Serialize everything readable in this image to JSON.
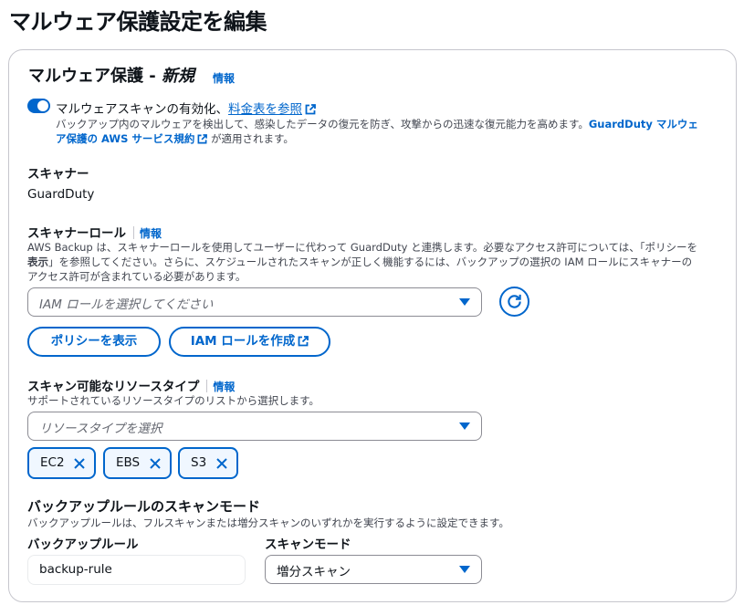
{
  "page": {
    "title": "マルウェア保護設定を編集"
  },
  "card": {
    "title": "マルウェア保護 - ",
    "title_new": "新規",
    "info": "情報"
  },
  "toggle": {
    "enabled": true,
    "label": "マルウェアスキャンの有効化、",
    "pricing_link": "料金表を参照",
    "desc_line1_text": "バックアップ内のマルウェアを検出して、感染したデータの復元を防ぎ、攻撃からの迅速な復元能力を高めます。",
    "desc_line1_link": "GuardDuty マルウェ",
    "desc_line2_link": "ア保護の AWS サービス規約",
    "desc_line2_suffix": " が適用されます。"
  },
  "scanner": {
    "label": "スキャナー",
    "value": "GuardDuty"
  },
  "scanner_role": {
    "label": "スキャナーロール",
    "info": "情報",
    "desc_line1": "AWS Backup は、スキャナーロールを使用してユーザーに代わって GuardDuty と連携します。必要なアクセス許可については、「ポリシーを",
    "desc_line2_bold": "表示",
    "desc_line2_rest": "」を参照してください。さらに、スケジュールされたスキャンが正しく機能するには、バックアップの選択の IAM ロールにスキャナーの",
    "desc_line3": "アクセス許可が含まれている必要があります。",
    "placeholder": "IAM ロールを選択してください",
    "view_policy_button": "ポリシーを表示",
    "create_role_button": "IAM ロールを作成"
  },
  "resource_types": {
    "label": "スキャン可能なリソースタイプ",
    "info": "情報",
    "desc": "サポートされているリソースタイプのリストから選択します。",
    "placeholder": "リソースタイプを選択",
    "tokens": [
      "EC2",
      "EBS",
      "S3"
    ]
  },
  "scan_mode": {
    "heading": "バックアップルールのスキャンモード",
    "desc": "バックアップルールは、フルスキャンまたは増分スキャンのいずれかを実行するように設定できます。",
    "rule_label": "バックアップルール",
    "rule_value": "backup-rule",
    "mode_label": "スキャンモード",
    "mode_value": "増分スキャン"
  },
  "colors": {
    "accent": "#0066cc",
    "text": "#0f141a",
    "muted": "#424650",
    "border": "#8c8c94"
  },
  "icons": [
    "external-link-icon",
    "refresh-icon",
    "remove-icon",
    "caret-down-icon"
  ]
}
